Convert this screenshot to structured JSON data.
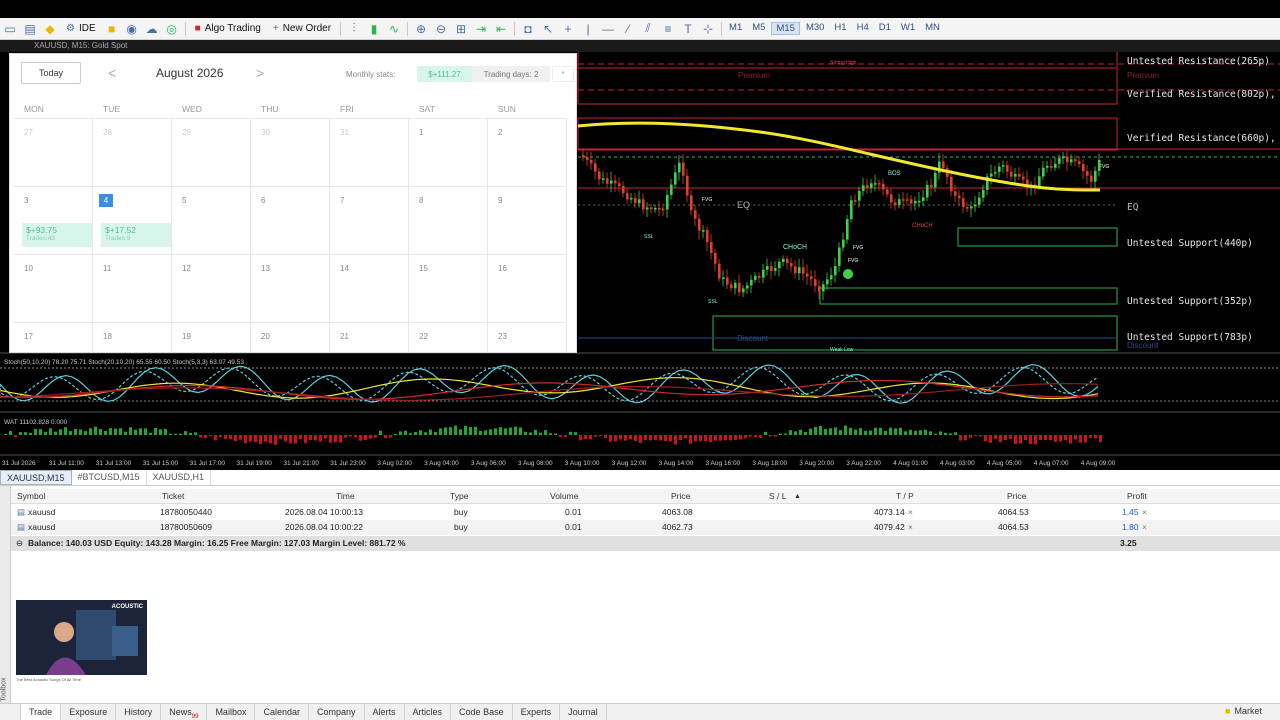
{
  "toolbar": {
    "ide_label": "IDE",
    "algo_label": "Algo Trading",
    "new_order_label": "New Order",
    "timeframes": [
      "M1",
      "M5",
      "M15",
      "M30",
      "H1",
      "H4",
      "D1",
      "W1",
      "MN"
    ],
    "active_timeframe": "M15"
  },
  "window": {
    "title": "XAUUSD, M15:  Gold Spot"
  },
  "calendar": {
    "today_label": "Today",
    "prev": "<",
    "next": ">",
    "month": "August 2026",
    "stats_label": "Monthly stats:",
    "stats_value": "$+111.27",
    "trading_days": "Trading days: 2",
    "star": "*",
    "weekdays": [
      "MON",
      "TUE",
      "WED",
      "THU",
      "FRI",
      "SAT",
      "SUN"
    ],
    "weeks": [
      [
        {
          "d": "27",
          "dim": true
        },
        {
          "d": "28",
          "dim": true
        },
        {
          "d": "29",
          "dim": true
        },
        {
          "d": "30",
          "dim": true
        },
        {
          "d": "31",
          "dim": true
        },
        {
          "d": "1"
        },
        {
          "d": "2"
        }
      ],
      [
        {
          "d": "3",
          "pnl": "$+93.75",
          "trades": "Trades:43"
        },
        {
          "d": "4",
          "today": true,
          "pnl": "$+17.52",
          "trades": "Trades:9"
        },
        {
          "d": "5"
        },
        {
          "d": "6"
        },
        {
          "d": "7"
        },
        {
          "d": "8"
        },
        {
          "d": "9"
        }
      ],
      [
        {
          "d": "10"
        },
        {
          "d": "11"
        },
        {
          "d": "12"
        },
        {
          "d": "13"
        },
        {
          "d": "14"
        },
        {
          "d": "15"
        },
        {
          "d": "16"
        }
      ],
      [
        {
          "d": "17"
        },
        {
          "d": "18"
        },
        {
          "d": "19"
        },
        {
          "d": "20"
        },
        {
          "d": "21"
        },
        {
          "d": "22"
        },
        {
          "d": "23"
        }
      ]
    ]
  },
  "chart": {
    "zones": [
      {
        "label": "Untested Resistance(265p)"
      },
      {
        "label": "Verified Resistance(802p), Test"
      },
      {
        "label": "Verified Resistance(660p), Test"
      },
      {
        "label": "EQ"
      },
      {
        "label": "Untested Support(440p)"
      },
      {
        "label": "Untested Support(352p)"
      },
      {
        "label": "Untested Support(783p)"
      }
    ],
    "tags": [
      "Premium",
      "Premium",
      "EQ",
      "Discount",
      "Discount",
      "BOS",
      "CHoCH",
      "CHoCH",
      "FVG",
      "FVG",
      "FVG",
      "FVG",
      "SSL",
      "SSL",
      "Strong High",
      "Weak Low"
    ],
    "stoch_label": "Stoch(50,10,20) 78.20 75.71 Stoch(20,10,20) 65.55 60.50 Stoch(5,3,3) 63.07 49.53",
    "wat_label": "WAT 11102.828 0.000",
    "time_axis": [
      "31 Jul 2026",
      "31 Jul 11:00",
      "31 Jul 13:00",
      "31 Jul 15:00",
      "31 Jul 17:00",
      "31 Jul 19:00",
      "31 Jul 21:00",
      "31 Jul 23:00",
      "3 Aug 02:00",
      "3 Aug 04:00",
      "3 Aug 06:00",
      "3 Aug 08:00",
      "3 Aug 10:00",
      "3 Aug 12:00",
      "3 Aug 14:00",
      "3 Aug 16:00",
      "3 Aug 18:00",
      "3 Aug 20:00",
      "3 Aug 22:00",
      "4 Aug 01:00",
      "4 Aug 03:00",
      "4 Aug 05:00",
      "4 Aug 07:00",
      "4 Aug 09:00"
    ],
    "colors": {
      "bull": "#3fd04a",
      "bear": "#e0402a",
      "ma": "#f2e830",
      "zone_red": "#c0243c",
      "zone_green": "#2fb352"
    }
  },
  "symbol_tabs": [
    "XAUUSD,M15",
    "#BTCUSD,M15",
    "XAUUSD,H1"
  ],
  "trade": {
    "headers": [
      "Symbol",
      "Ticket",
      "Time",
      "Type",
      "Volume",
      "Price",
      "S / L",
      "T / P",
      "Price",
      "Profit"
    ],
    "rows": [
      {
        "symbol": "xauusd",
        "ticket": "18780050440",
        "time": "2026.08.04 10:00:13",
        "type": "buy",
        "volume": "0.01",
        "price": "4063.08",
        "sl": "",
        "tp": "4073.14",
        "cur": "4064.53",
        "profit": "1.45"
      },
      {
        "symbol": "xauusd",
        "ticket": "18780050609",
        "time": "2026.08.04 10:00:22",
        "type": "buy",
        "volume": "0.01",
        "price": "4062.73",
        "sl": "",
        "tp": "4079.42",
        "cur": "4064.53",
        "profit": "1.80"
      }
    ],
    "balance_line": "Balance: 140.03 USD  Equity: 143.28  Margin: 16.25  Free Margin: 127.03  Margin Level: 881.72 %",
    "total_profit": "3.25"
  },
  "thumbnail": {
    "title": "ACOUSTIC",
    "caption": "The Best Acoustic Songs Of All Time"
  },
  "bottom_tabs": [
    {
      "label": "Trade",
      "active": true
    },
    {
      "label": "Exposure"
    },
    {
      "label": "History"
    },
    {
      "label": "News",
      "badge": "99"
    },
    {
      "label": "Mailbox"
    },
    {
      "label": "Calendar"
    },
    {
      "label": "Company"
    },
    {
      "label": "Alerts"
    },
    {
      "label": "Articles"
    },
    {
      "label": "Code Base"
    },
    {
      "label": "Experts"
    },
    {
      "label": "Journal"
    }
  ],
  "toolbox_label": "Toolbox",
  "market_label": "Market"
}
